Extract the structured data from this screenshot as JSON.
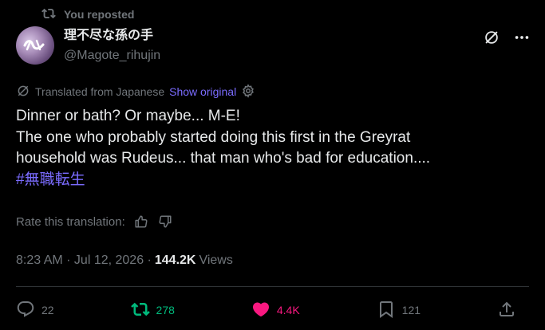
{
  "repost_banner": {
    "text": "You reposted"
  },
  "author": {
    "display_name": "理不尽な孫の手",
    "handle": "@Magote_rihujin"
  },
  "translation": {
    "label": "Translated from Japanese",
    "show_original": "Show original"
  },
  "tweet": {
    "lines": [
      "Dinner or bath? Or maybe... M-E!",
      "The one who probably started doing this first in the Greyrat",
      "household was Rudeus... that man who's bad for education...."
    ],
    "hashtag": "#無職転生"
  },
  "rate": {
    "label": "Rate this translation:"
  },
  "meta": {
    "time": "8:23 AM · Jul 12, 2026 · ",
    "views_count": "144.2K",
    "views_label": "Views"
  },
  "actions": {
    "replies": "22",
    "reposts": "278",
    "likes": "4.4K",
    "bookmarks": "121"
  },
  "colors": {
    "background": "#000000",
    "text": "#e7e9ea",
    "muted": "#71767b",
    "link": "#7b6cff",
    "repost": "#00ba7c",
    "like": "#f91880",
    "divider": "#2f3336"
  },
  "icons": [
    "repost-icon",
    "grok-icon",
    "more-icon",
    "translate-icon",
    "settings-icon",
    "thumbs-up-icon",
    "thumbs-down-icon",
    "reply-icon",
    "repost-icon",
    "like-icon",
    "bookmark-icon",
    "share-icon"
  ]
}
